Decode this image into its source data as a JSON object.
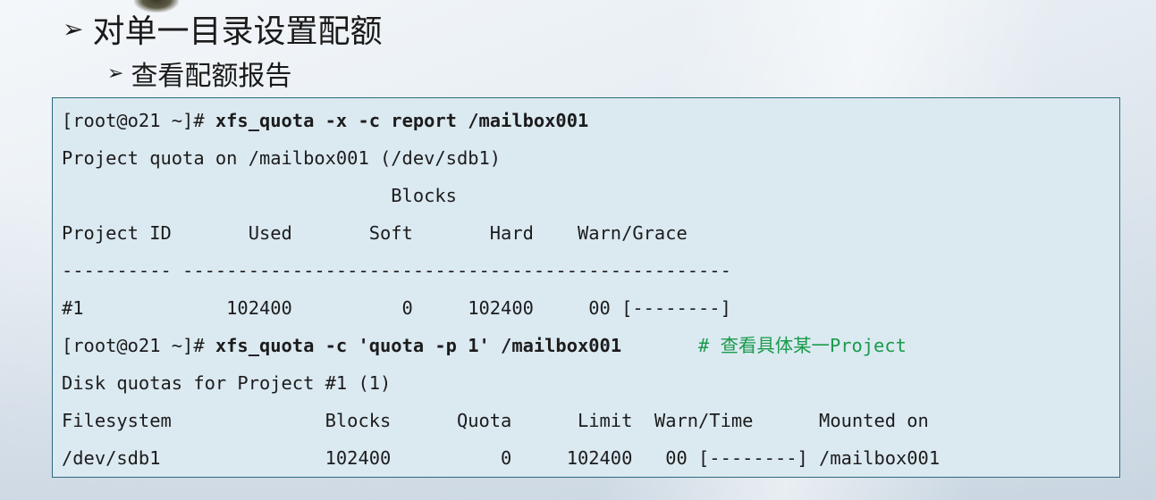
{
  "slide": {
    "title": "对单一目录设置配额",
    "subtitle": "查看配额报告",
    "bullet_glyph": "➢"
  },
  "terminal": {
    "lines": [
      {
        "prompt": "[root@o21 ~]# ",
        "command": "xfs_quota -x -c report /mailbox001",
        "gap": "",
        "comment": ""
      },
      {
        "text": "Project quota on /mailbox001 (/dev/sdb1)"
      },
      {
        "text": "                              Blocks"
      },
      {
        "text": "Project ID       Used       Soft       Hard    Warn/Grace"
      },
      {
        "text": "---------- --------------------------------------------------"
      },
      {
        "text": "#1             102400          0     102400     00 [--------]"
      },
      {
        "prompt": "[root@o21 ~]# ",
        "command": "xfs_quota -c 'quota -p 1' /mailbox001",
        "gap": "       ",
        "comment": "# 查看具体某一Project"
      },
      {
        "text": "Disk quotas for Project #1 (1)"
      },
      {
        "text": "Filesystem              Blocks      Quota      Limit  Warn/Time      Mounted on"
      },
      {
        "text": "/dev/sdb1               102400          0     102400   00 [--------] /mailbox001"
      }
    ]
  },
  "colors": {
    "terminal_bg": "#dbe9f1",
    "terminal_border": "#2c6a7c",
    "comment": "#1a9b4b",
    "text": "#1c1c1c"
  }
}
